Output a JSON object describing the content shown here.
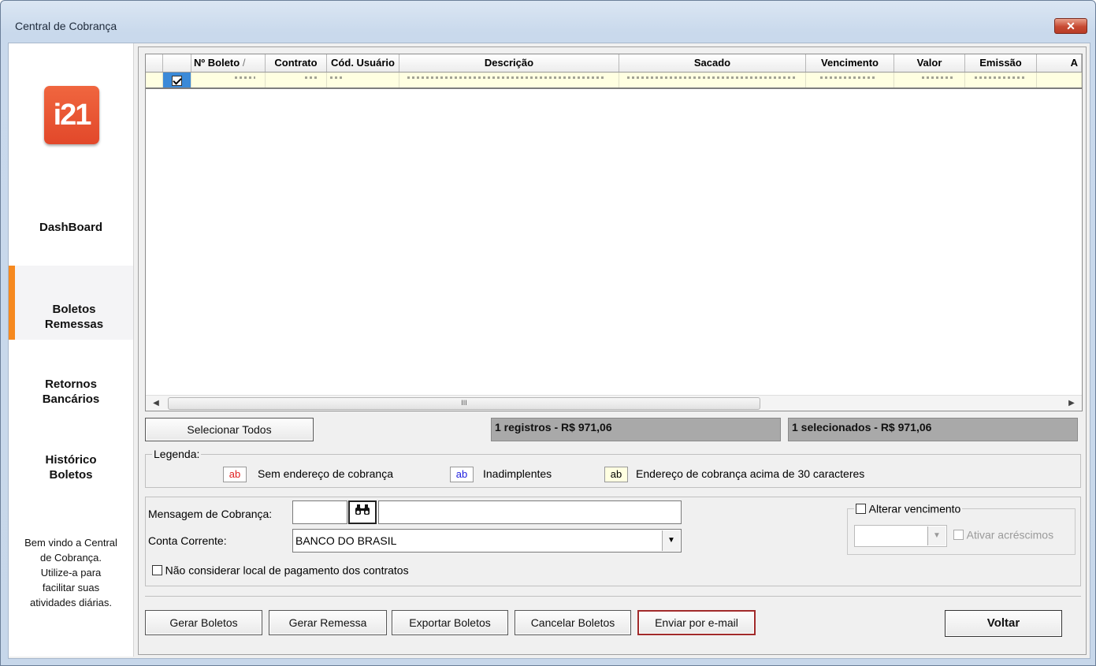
{
  "window": {
    "title": "Central de Cobrança",
    "close_label": "✕"
  },
  "sidebar": {
    "logo_text": "i21",
    "items": [
      {
        "label": "DashBoard",
        "active": false
      },
      {
        "label": "Boletos\nRemessas",
        "active": true
      },
      {
        "label": "Retornos\nBancários",
        "active": false
      },
      {
        "label": "Histórico\nBoletos",
        "active": false
      }
    ],
    "welcome": "Bem vindo a Central de Cobrança. Utilize-a para facilitar suas atividades diárias."
  },
  "grid": {
    "columns": [
      "",
      "",
      "Nº Boleto",
      "Contrato",
      "Cód. Usuário",
      "Descrição",
      "Sacado",
      "Vencimento",
      "Valor",
      "Emissão",
      "A"
    ],
    "sort_indicator": "/",
    "rows": [
      {
        "selected": true
      }
    ],
    "scroll_thumb_glyph": "III"
  },
  "actions": {
    "select_all": "Selecionar Todos"
  },
  "summary": {
    "records": "1 registros - R$ 971,06",
    "selected": "1 selecionados - R$ 971,06"
  },
  "legend": {
    "title": "Legenda:",
    "items": [
      {
        "sample": "ab",
        "color": "#e02020",
        "bg": "#ffffff",
        "text": "Sem endereço de cobrança"
      },
      {
        "sample": "ab",
        "color": "#2020e0",
        "bg": "#ffffff",
        "text": "Inadimplentes"
      },
      {
        "sample": "ab",
        "color": "#000000",
        "bg": "#ffffe1",
        "text": "Endereço de cobrança acima de 30 caracteres"
      }
    ]
  },
  "form": {
    "mensagem_label": "Mensagem de Cobrança:",
    "mensagem_code": "",
    "mensagem_text": "",
    "conta_label": "Conta Corrente:",
    "conta_value": "BANCO DO BRASIL",
    "nao_considerar_label": "Não considerar local de pagamento dos contratos",
    "nao_considerar_checked": false,
    "alterar_vencimento_label": "Alterar vencimento",
    "alterar_vencimento_checked": false,
    "vencimento_value": "",
    "ativar_acrescimos_label": "Ativar acréscimos"
  },
  "buttons": {
    "gerar_boletos": "Gerar  Boletos",
    "gerar_remessa": "Gerar Remessa",
    "exportar_boletos": "Exportar Boletos",
    "cancelar_boletos": "Cancelar Boletos",
    "enviar_email": "Enviar por e-mail",
    "voltar": "Voltar"
  },
  "colors": {
    "accent": "#f6891f",
    "logo": "#e8502f",
    "highlight_border": "#a12a2a",
    "row_bg": "#ffffe1"
  }
}
